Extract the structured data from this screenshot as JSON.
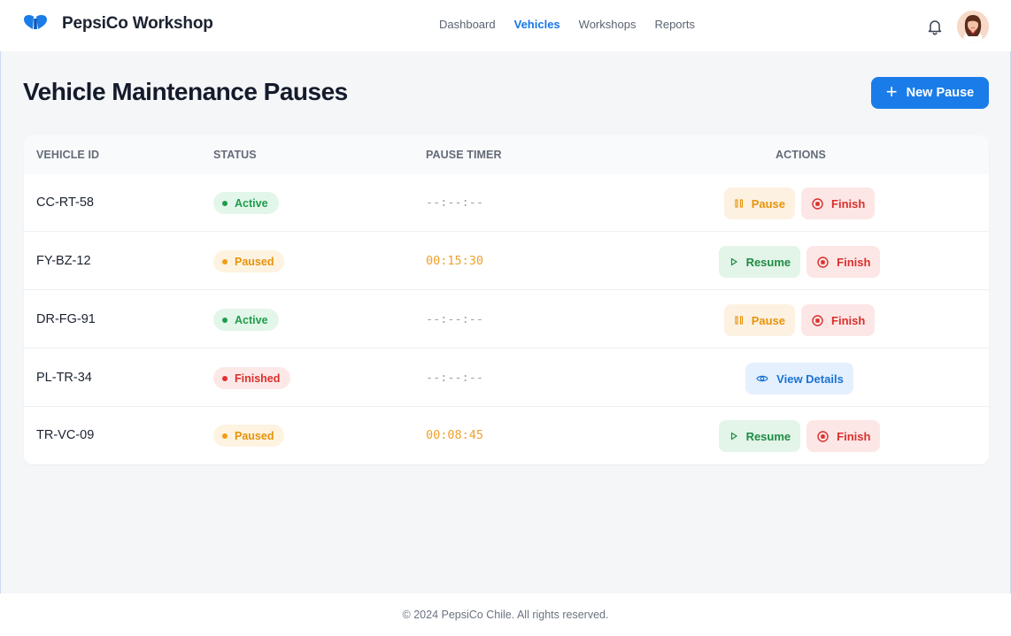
{
  "app": {
    "name": "PepsiCo Workshop"
  },
  "nav": {
    "items": [
      {
        "label": "Dashboard",
        "active": false
      },
      {
        "label": "Vehicles",
        "active": true
      },
      {
        "label": "Workshops",
        "active": false
      },
      {
        "label": "Reports",
        "active": false
      }
    ]
  },
  "header": {
    "notification_icon": "bell-icon",
    "avatar_icon": "user-avatar"
  },
  "page": {
    "title": "Vehicle Maintenance Pauses",
    "new_button_label": "New Pause",
    "new_button_icon": "plus-icon"
  },
  "table": {
    "headers": {
      "vehicle_id": "VEHICLE ID",
      "status": "STATUS",
      "pause_timer": "PAUSE TIMER",
      "actions": "ACTIONS"
    },
    "rows": [
      {
        "vehicle_id": "CC-RT-58",
        "status": "Active",
        "timer": "--:--:--",
        "actions": [
          {
            "label": "Pause",
            "icon": "pause-icon"
          },
          {
            "label": "Finish",
            "icon": "stop-circle-icon"
          }
        ]
      },
      {
        "vehicle_id": "FY-BZ-12",
        "status": "Paused",
        "timer": "00:15:30",
        "actions": [
          {
            "label": "Resume",
            "icon": "play-icon"
          },
          {
            "label": "Finish",
            "icon": "stop-circle-icon"
          }
        ]
      },
      {
        "vehicle_id": "DR-FG-91",
        "status": "Active",
        "timer": "--:--:--",
        "actions": [
          {
            "label": "Pause",
            "icon": "pause-icon"
          },
          {
            "label": "Finish",
            "icon": "stop-circle-icon"
          }
        ]
      },
      {
        "vehicle_id": "PL-TR-34",
        "status": "Finished",
        "timer": "--:--:--",
        "actions": [
          {
            "label": "View Details",
            "icon": "eye-icon"
          }
        ]
      },
      {
        "vehicle_id": "TR-VC-09",
        "status": "Paused",
        "timer": "00:08:45",
        "actions": [
          {
            "label": "Resume",
            "icon": "play-icon"
          },
          {
            "label": "Finish",
            "icon": "stop-circle-icon"
          }
        ]
      }
    ]
  },
  "colors": {
    "accent": "#1a7ce8",
    "active": "#1f9d4b",
    "paused": "#e8930c",
    "finished": "#d9302c"
  },
  "footer": {
    "text": "© 2024 PepsiCo Chile. All rights reserved."
  }
}
